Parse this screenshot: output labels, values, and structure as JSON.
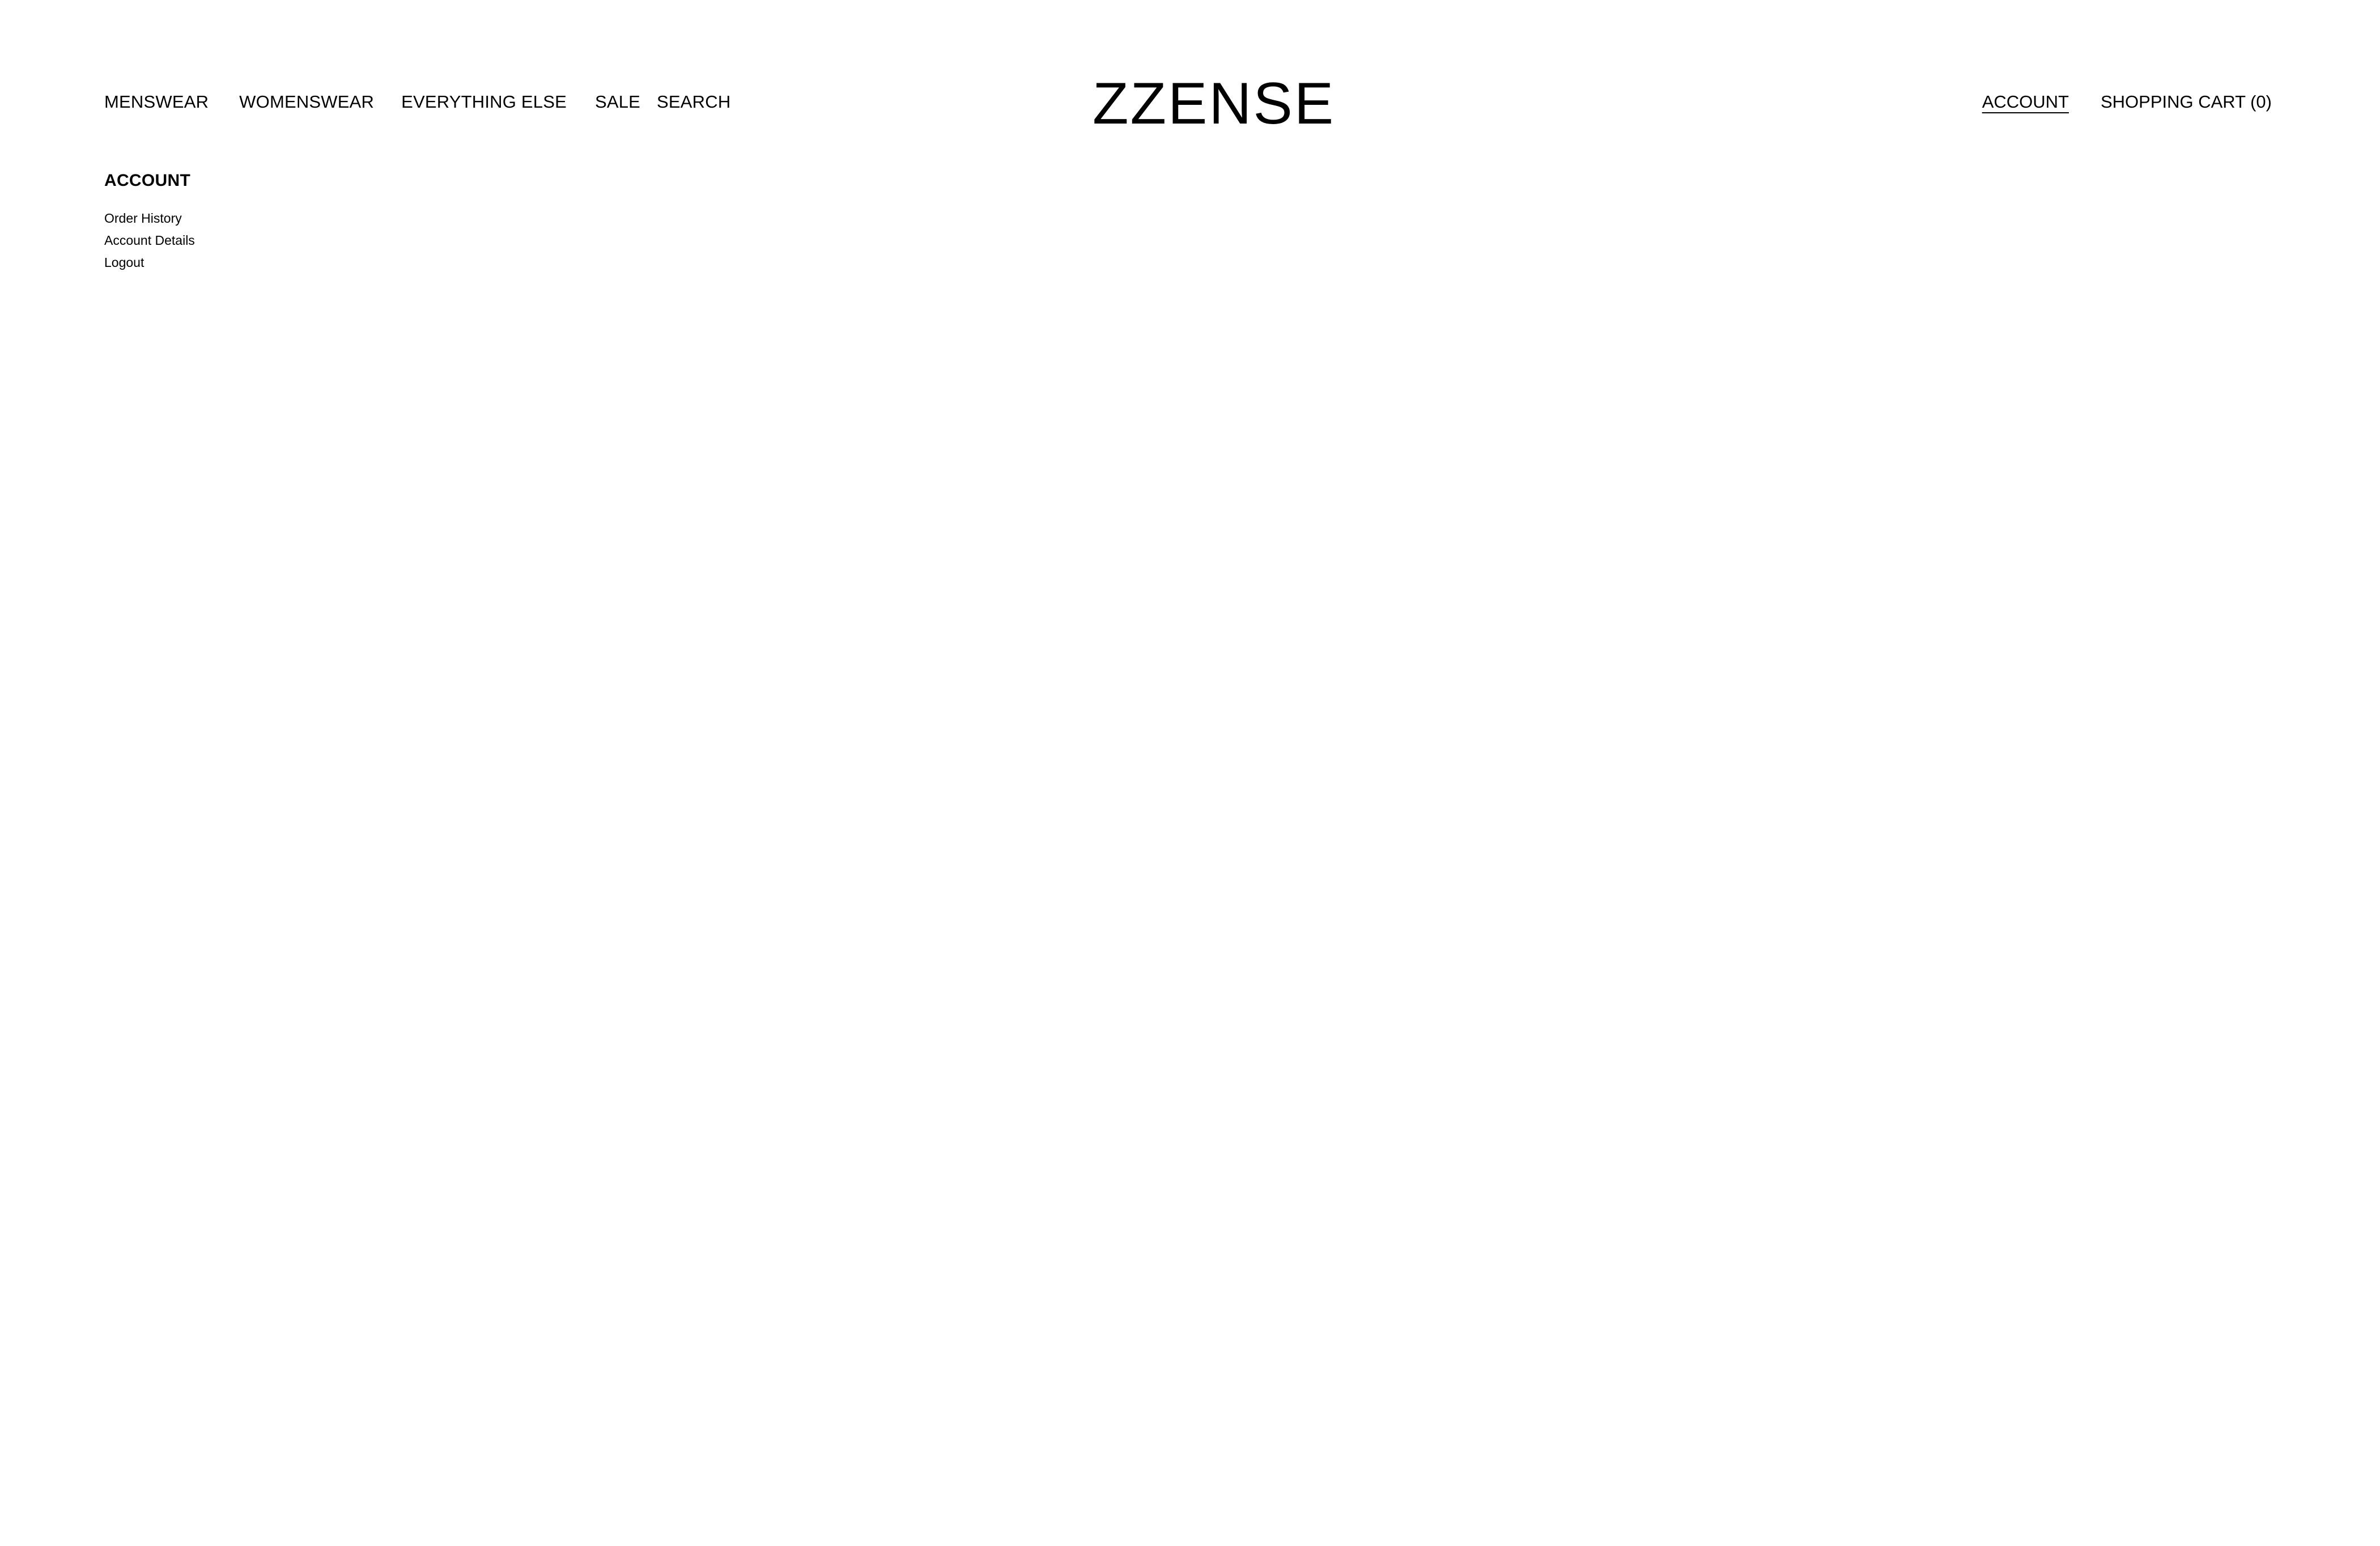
{
  "header": {
    "nav_left": [
      {
        "label": "MENSWEAR"
      },
      {
        "label": "WOMENSWEAR"
      },
      {
        "label": "EVERYTHING ELSE"
      },
      {
        "label": "SALE"
      },
      {
        "label": "SEARCH"
      }
    ],
    "logo": "ZZENSE",
    "nav_right": {
      "account_label": "ACCOUNT",
      "cart_label": "SHOPPING CART (0)"
    }
  },
  "account_menu": {
    "title": "ACCOUNT",
    "items": [
      {
        "label": "Order History"
      },
      {
        "label": "Account Details"
      },
      {
        "label": "Logout"
      }
    ]
  },
  "colors": {
    "background": "#ffffff",
    "text": "#000000"
  }
}
